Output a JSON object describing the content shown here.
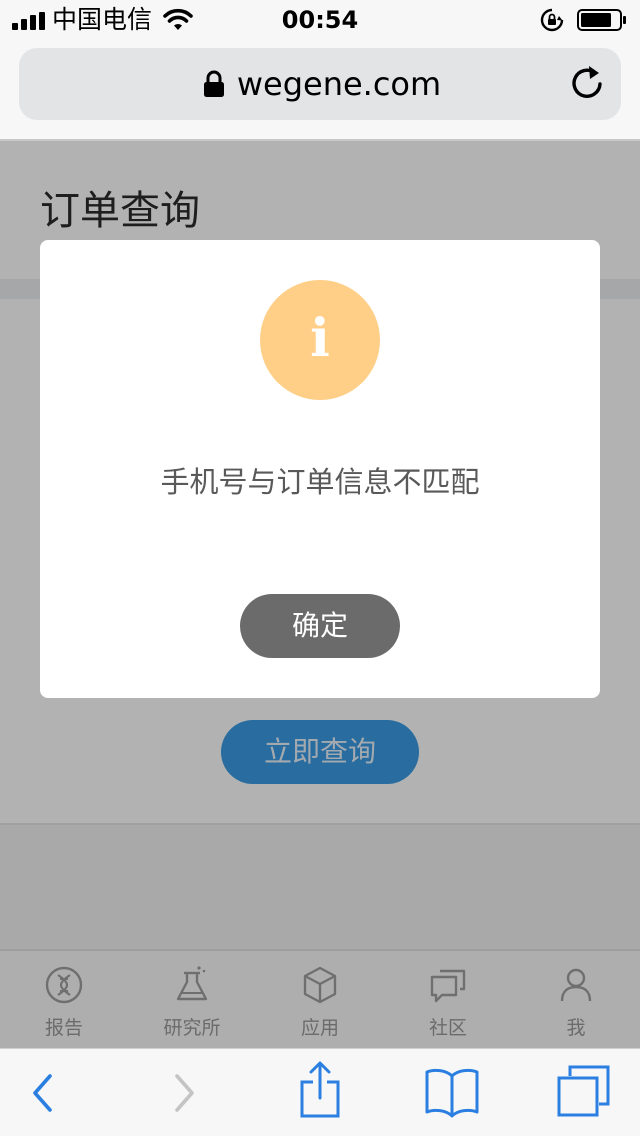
{
  "status_bar": {
    "carrier": "中国电信",
    "time": "00:54"
  },
  "browser": {
    "url": "wegene.com"
  },
  "page": {
    "title": "订单查询",
    "query_button_label": "立即查询"
  },
  "app_tabs": [
    {
      "label": "报告",
      "icon": "dna-icon"
    },
    {
      "label": "研究所",
      "icon": "flask-icon"
    },
    {
      "label": "应用",
      "icon": "cube-icon"
    },
    {
      "label": "社区",
      "icon": "chat-bubbles-icon"
    },
    {
      "label": "我",
      "icon": "user-icon"
    }
  ],
  "modal": {
    "icon": "info-icon",
    "icon_glyph": "i",
    "message": "手机号与订单信息不匹配",
    "confirm_label": "确定"
  },
  "colors": {
    "modal_icon_bg": "#ffcf87",
    "confirm_button_bg": "#6b6b6b",
    "query_button_bg": "#3a9be6",
    "safari_tint": "#2b7fe0"
  }
}
